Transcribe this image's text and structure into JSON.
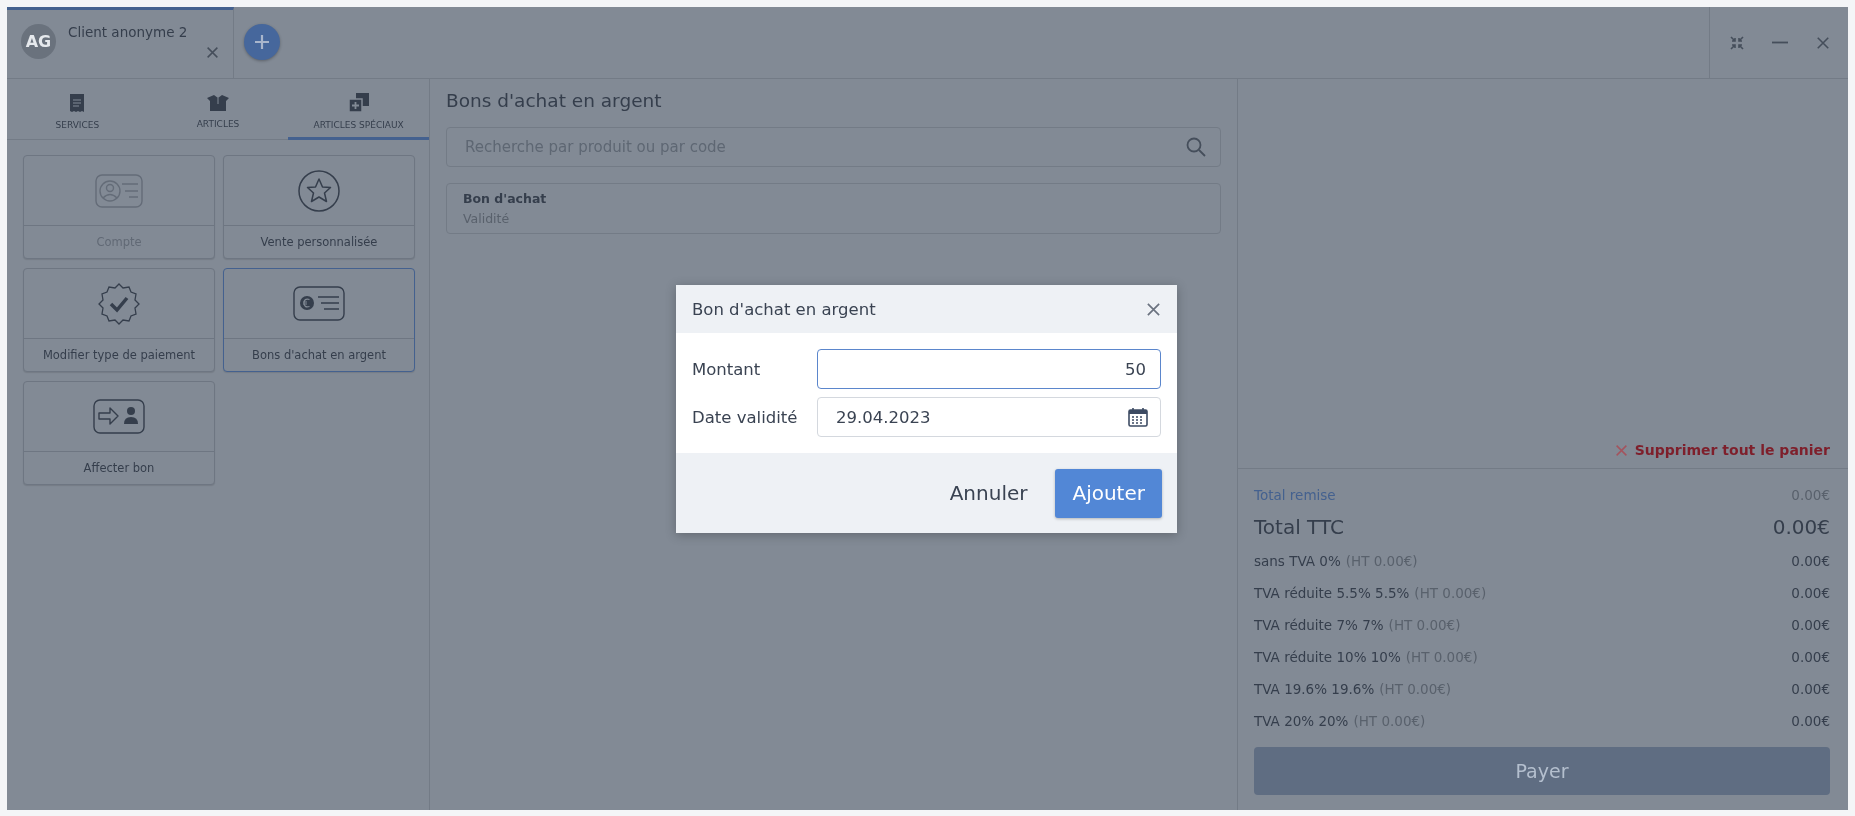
{
  "client_tabs": [
    {
      "initials": "AG",
      "name": "Client anonyme 2",
      "selected": true
    }
  ],
  "category_tabs": [
    {
      "label": "SERVICES",
      "selected": false
    },
    {
      "label": "ARTICLES",
      "selected": false
    },
    {
      "label": "ARTICLES SPÉCIAUX",
      "selected": true
    }
  ],
  "tiles": [
    {
      "label": "Compte",
      "disabled": true,
      "selected": false
    },
    {
      "label": "Vente personnalisée",
      "disabled": false,
      "selected": false
    },
    {
      "label": "Modifier type de paiement",
      "disabled": false,
      "selected": false
    },
    {
      "label": "Bons d'achat en argent",
      "disabled": false,
      "selected": true
    },
    {
      "label": "Affecter bon",
      "disabled": false,
      "selected": false
    }
  ],
  "catalog": {
    "title": "Bons d'achat en argent",
    "search": {
      "placeholder": "Recherche par produit ou par code"
    },
    "items": [
      {
        "name": "Bon d'achat",
        "detail": "Validité"
      }
    ]
  },
  "cart": {
    "clear_label": "Supprimer tout le panier",
    "totals": [
      {
        "kind": "discount",
        "label": "Total remise",
        "value": "0.00€"
      },
      {
        "kind": "total",
        "label": "Total TTC",
        "value": "0.00€"
      },
      {
        "kind": "tax",
        "label": "sans TVA 0%",
        "note": "(HT 0.00€)",
        "value": "0.00€"
      },
      {
        "kind": "tax",
        "label": "TVA réduite 5.5% 5.5%",
        "note": "(HT 0.00€)",
        "value": "0.00€"
      },
      {
        "kind": "tax",
        "label": "TVA réduite 7% 7%",
        "note": "(HT 0.00€)",
        "value": "0.00€"
      },
      {
        "kind": "tax",
        "label": "TVA réduite 10% 10%",
        "note": "(HT 0.00€)",
        "value": "0.00€"
      },
      {
        "kind": "tax",
        "label": "TVA 19.6% 19.6%",
        "note": "(HT 0.00€)",
        "value": "0.00€"
      },
      {
        "kind": "tax",
        "label": "TVA 20% 20%",
        "note": "(HT 0.00€)",
        "value": "0.00€"
      }
    ],
    "pay_button": {
      "label": "Payer",
      "disabled": true
    }
  },
  "dialog": {
    "title": "Bon d'achat en argent",
    "fields": [
      {
        "kind": "number",
        "label": "Montant",
        "value": "50",
        "focused": true
      },
      {
        "kind": "date",
        "label": "Date validité",
        "value": "29.04.2023",
        "focused": false
      }
    ],
    "buttons": [
      {
        "kind": "secondary",
        "label": "Annuler"
      },
      {
        "kind": "primary",
        "label": "Ajouter"
      }
    ]
  }
}
